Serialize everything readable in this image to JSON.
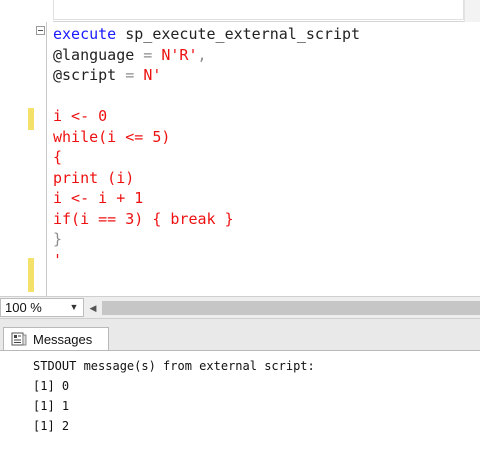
{
  "editor": {
    "lines": [
      {
        "segments": [
          {
            "text": "execute ",
            "cls": "kw"
          },
          {
            "text": "sp_execute_external_script",
            "cls": "plain"
          }
        ]
      },
      {
        "segments": [
          {
            "text": "@language",
            "cls": "plain"
          },
          {
            "text": " = ",
            "cls": "gray"
          },
          {
            "text": "N'R'",
            "cls": "str"
          },
          {
            "text": ",",
            "cls": "gray"
          }
        ]
      },
      {
        "segments": [
          {
            "text": "@script",
            "cls": "plain"
          },
          {
            "text": " = ",
            "cls": "gray"
          },
          {
            "text": "N'",
            "cls": "str"
          }
        ]
      },
      {
        "segments": [
          {
            "text": "",
            "cls": "plain"
          }
        ]
      },
      {
        "segments": [
          {
            "text": "i <- 0",
            "cls": "str"
          }
        ]
      },
      {
        "segments": [
          {
            "text": "while(i <= 5)",
            "cls": "str"
          }
        ]
      },
      {
        "segments": [
          {
            "text": "{",
            "cls": "str"
          }
        ]
      },
      {
        "segments": [
          {
            "text": "print (i)",
            "cls": "str"
          }
        ]
      },
      {
        "segments": [
          {
            "text": "i <- i + 1",
            "cls": "str"
          }
        ]
      },
      {
        "segments": [
          {
            "text": "if(i == 3) { break }",
            "cls": "str"
          }
        ]
      },
      {
        "segments": [
          {
            "text": "}",
            "cls": "gray"
          }
        ]
      },
      {
        "segments": [
          {
            "text": "'",
            "cls": "str"
          }
        ]
      }
    ],
    "colors": {
      "keyword": "#1a1aff",
      "string": "#ee1111",
      "operator": "#8c8c8c",
      "change_marker": "#f4e16a"
    }
  },
  "zoom": {
    "value": "100 %"
  },
  "results": {
    "tab_label": "Messages",
    "tab_icon": "messages-icon",
    "output_lines": [
      "STDOUT message(s) from external script:",
      "[1] 0",
      "[1] 1",
      "[1] 2"
    ]
  }
}
